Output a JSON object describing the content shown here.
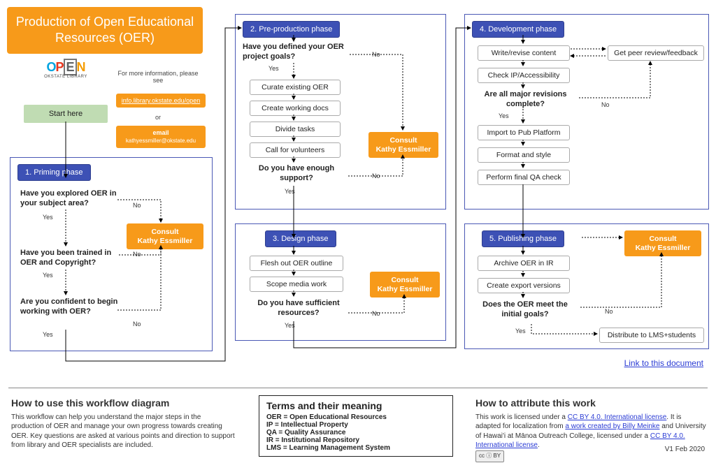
{
  "title": "Production of Open Educational Resources (OER)",
  "logo": {
    "o1": "O",
    "p": "P",
    "e": "E",
    "n": "N",
    "sub": "OKSTATE LIBRARY"
  },
  "start_here": "Start here",
  "info_text": "For more information, please see",
  "info_link": "info.library.okstate.edu/open",
  "or": "or",
  "email_label": "email",
  "email_addr": "kathyessmiller@okstate.edu",
  "labels": {
    "yes": "Yes",
    "no": "No"
  },
  "consult": {
    "line1": "Consult",
    "line2": "Kathy Essmiller",
    "single": "Consult Kathy Essmiller"
  },
  "phases": {
    "p1": {
      "header": "1. Priming phase",
      "q1": "Have you explored OER in your subject area?",
      "q2": "Have you been trained in OER and Copyright?",
      "q3": "Are you confident to begin working with OER?"
    },
    "p2": {
      "header": "2. Pre-production phase",
      "q1": "Have you defined your OER project goals?",
      "s1": "Curate existing OER",
      "s2": "Create working docs",
      "s3": "Divide tasks",
      "s4": "Call for volunteers",
      "q2": "Do you have enough support?"
    },
    "p3": {
      "header": "3. Design phase",
      "s1": "Flesh out OER outline",
      "s2": "Scope media work",
      "q1": "Do you have sufficient resources?"
    },
    "p4": {
      "header": "4. Development phase",
      "s1": "Write/revise content",
      "s1b": "Get peer review/feedback",
      "s2": "Check IP/Accessibility",
      "q1": "Are all major revisions complete?",
      "s3": "Import to Pub Platform",
      "s4": "Format and style",
      "s5": "Perform final QA check"
    },
    "p5": {
      "header": "5. Publishing phase",
      "s1": "Archive OER in IR",
      "s2": "Create export versions",
      "q1": "Does the OER meet the initial goals?",
      "s3": "Distribute to LMS+students"
    }
  },
  "doclink": "Link to this document",
  "footer": {
    "how_use_h": "How to use this workflow diagram",
    "how_use_p": "This workflow can help you understand the major steps in the production of OER and manage your own progress towards creating OER. Key questions are asked at various points and direction to support from library and OER specialists are included.",
    "terms_h": "Terms and their meaning",
    "terms": {
      "oer": "OER = Open Educational Resources",
      "ip": "IP = Intellectual Property",
      "qa": "QA = Quality Assurance",
      "ir": "IR = Institutional Repository",
      "lms": "LMS = Learning Management System"
    },
    "attrib_h": "How to attribute this work",
    "attrib_p1a": "This work is licensed under a ",
    "attrib_lic1": "CC BY 4.0. International license",
    "attrib_p1b": ". It is adapted for localization from ",
    "attrib_work": "a work created by Billy Meinke",
    "attrib_p1c": " and University of Hawai'i at Mānoa Outreach College, licensed under a ",
    "attrib_lic2": "CC BY 4.0. International license",
    "attrib_p1d": ".",
    "cc": "cc ⓘ BY"
  },
  "version": "V1 Feb 2020"
}
